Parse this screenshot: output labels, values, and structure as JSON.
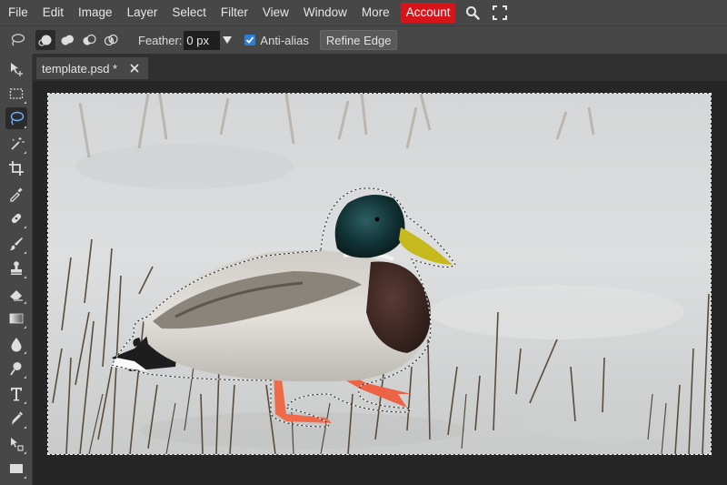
{
  "menubar": {
    "items": [
      "File",
      "Edit",
      "Image",
      "Layer",
      "Select",
      "Filter",
      "View",
      "Window",
      "More"
    ],
    "account_label": "Account",
    "icons": [
      "search-icon",
      "fullscreen-icon"
    ]
  },
  "options": {
    "feather_label": "Feather:",
    "feather_value": "0 px",
    "antialias_label": "Anti-alias",
    "antialias_checked": true,
    "refine_label": "Refine Edge"
  },
  "tools": [
    "move-icon",
    "marquee-icon",
    "lasso-icon",
    "magic-wand-icon",
    "crop-icon",
    "eyedropper-icon",
    "healing-icon",
    "brush-icon",
    "stamp-icon",
    "eraser-icon",
    "gradient-icon",
    "blur-icon",
    "dodge-icon",
    "type-icon",
    "pen-icon",
    "path-select-icon",
    "shape-icon"
  ],
  "active_tool": "lasso-icon",
  "document": {
    "tab_title": "template.psd *"
  },
  "colors": {
    "account": "#d8141b",
    "panel": "#474747",
    "workspace": "#262626",
    "checkbox": "#2a7fd8"
  }
}
